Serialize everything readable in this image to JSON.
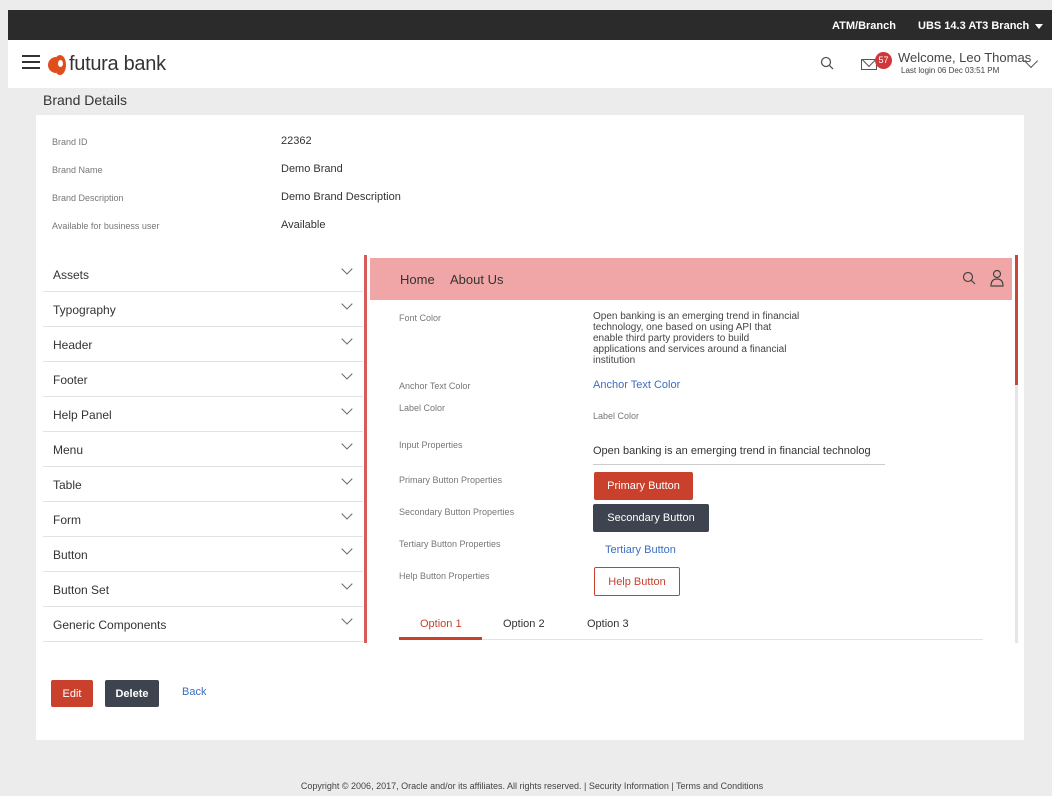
{
  "topbar": {
    "atm_label": "ATM/Branch",
    "branch_label": "UBS 14.3 AT3 Branch"
  },
  "header": {
    "brand": "futura bank",
    "notification_count": "57",
    "welcome": "Welcome, Leo Thomas",
    "last_login": "Last login 06 Dec 03:51 PM"
  },
  "page": {
    "title": "Brand Details"
  },
  "details": [
    {
      "label": "Brand ID",
      "value": "22362"
    },
    {
      "label": "Brand Name",
      "value": "Demo Brand"
    },
    {
      "label": "Brand Description",
      "value": "Demo Brand Description"
    },
    {
      "label": "Available for business user",
      "value": "Available"
    }
  ],
  "accordion": [
    "Assets",
    "Typography",
    "Header",
    "Footer",
    "Help Panel",
    "Menu",
    "Table",
    "Form",
    "Button",
    "Button Set",
    "Generic Components"
  ],
  "preview": {
    "nav_home": "Home",
    "nav_about": "About Us",
    "font_color_label": "Font Color",
    "font_color_text": "Open banking is an emerging trend in financial technology, one based on using API that enable third party providers to build applications and services around a financial institution",
    "anchor_label": "Anchor Text Color",
    "anchor_text": "Anchor Text Color",
    "label_color_label": "Label Color",
    "label_color_text": "Label Color",
    "input_label": "Input Properties",
    "input_value": "Open banking is an emerging trend in financial technolog",
    "primary_label": "Primary Button Properties",
    "primary_button": "Primary Button",
    "secondary_label": "Secondary Button Properties",
    "secondary_button": "Secondary Button",
    "tertiary_label": "Tertiary Button Properties",
    "tertiary_button": "Tertiary Button",
    "help_label": "Help Button Properties",
    "help_button": "Help Button",
    "tabs": [
      "Option 1",
      "Option 2",
      "Option 3"
    ]
  },
  "actions": {
    "edit": "Edit",
    "delete": "Delete",
    "back": "Back"
  },
  "footer": {
    "text": "Copyright © 2006, 2017, Oracle and/or its affiliates. All rights reserved. | Security Information | Terms and Conditions"
  },
  "colors": {
    "primary": "#c9402d",
    "secondary": "#3e4350",
    "link": "#3b6fc0",
    "preview_nav": "#f0a6a6"
  }
}
